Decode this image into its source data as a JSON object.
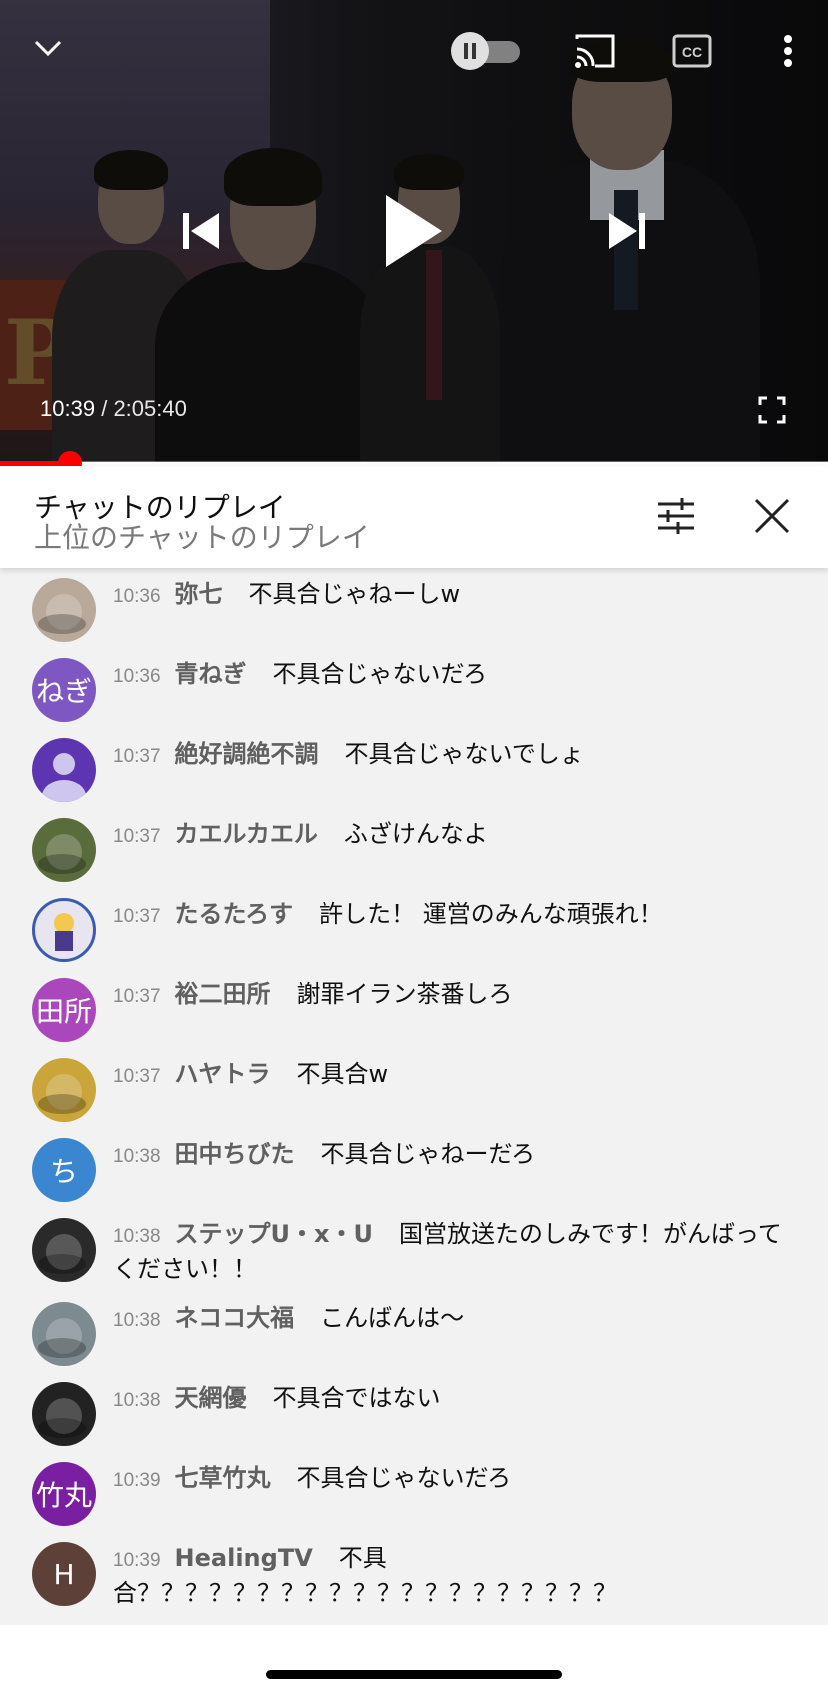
{
  "player": {
    "current_time": "10:39",
    "separator": "/",
    "duration": "2:05:40",
    "progress_fraction": 0.085,
    "sign_text": "P!"
  },
  "chat": {
    "title": "チャットのリプレイ",
    "subtitle": "上位のチャットのリプレイ",
    "messages": [
      {
        "time": "10:36",
        "author": "弥七",
        "text": "不具合じゃねーしw",
        "avatar_text": "",
        "avatar_color": "#b9a99a"
      },
      {
        "time": "10:36",
        "author": "青ねぎ",
        "text": "不具合じゃないだろ",
        "avatar_text": "ねぎ",
        "avatar_color": "#7e57c2"
      },
      {
        "time": "10:37",
        "author": "絶好調絶不調",
        "text": "不具合じゃないでしょ",
        "avatar_text": "",
        "avatar_color": "#5e35b1"
      },
      {
        "time": "10:37",
        "author": "カエルカエル",
        "text": "ふざけんなよ",
        "avatar_text": "",
        "avatar_color": "#5a6b3c"
      },
      {
        "time": "10:37",
        "author": "たるたろす",
        "text": "許した！ 運営のみんな頑張れ！",
        "avatar_text": "",
        "avatar_color": "#e8e4f0"
      },
      {
        "time": "10:37",
        "author": "裕二田所",
        "text": "謝罪イラン茶番しろ",
        "avatar_text": "田所",
        "avatar_color": "#ab47bc"
      },
      {
        "time": "10:37",
        "author": "ハヤトラ",
        "text": "不具合w",
        "avatar_text": "",
        "avatar_color": "#caa53a"
      },
      {
        "time": "10:38",
        "author": "田中ちびた",
        "text": "不具合じゃねーだろ",
        "avatar_text": "ち",
        "avatar_color": "#3b86d1"
      },
      {
        "time": "10:38",
        "author": "ステップU・x・U",
        "text": "国営放送たのしみです！がんばってください！！",
        "avatar_text": "",
        "avatar_color": "#2a2a2a"
      },
      {
        "time": "10:38",
        "author": "ネココ大福",
        "text": "こんばんは〜",
        "avatar_text": "",
        "avatar_color": "#7d8a90"
      },
      {
        "time": "10:38",
        "author": "天網優",
        "text": "不具合ではない",
        "avatar_text": "",
        "avatar_color": "#222"
      },
      {
        "time": "10:39",
        "author": "七草竹丸",
        "text": "不具合じゃないだろ",
        "avatar_text": "竹丸",
        "avatar_color": "#7b1fa2"
      },
      {
        "time": "10:39",
        "author": "HealingTV",
        "text": "不具合？？？？？？？？？？？？？？？？？？？？",
        "avatar_text": "H",
        "avatar_color": "#5d4037"
      }
    ]
  },
  "icons": {
    "collapse": "chevron-down-icon",
    "autoplay": "autoplay-toggle",
    "cast": "cast-icon",
    "cc": "closed-captions-icon",
    "more": "more-vert-icon",
    "prev": "skip-previous-icon",
    "play": "play-icon",
    "next": "skip-next-icon",
    "fullscreen": "fullscreen-icon",
    "filter": "filter-icon",
    "close": "close-icon"
  }
}
